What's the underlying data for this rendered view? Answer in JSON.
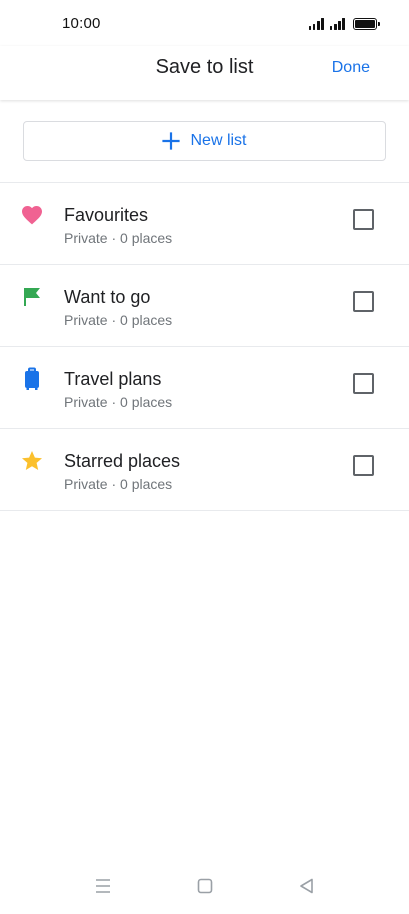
{
  "status_bar": {
    "time": "10:00"
  },
  "header": {
    "title": "Save to list",
    "done_label": "Done"
  },
  "new_list": {
    "label": "New list"
  },
  "lists": [
    {
      "title": "Favourites",
      "subtitle": "Private · 0 places",
      "icon": "heart-icon",
      "icon_color": "#f06292",
      "checked": false
    },
    {
      "title": "Want to go",
      "subtitle": "Private · 0 places",
      "icon": "flag-icon",
      "icon_color": "#34a853",
      "checked": false
    },
    {
      "title": "Travel plans",
      "subtitle": "Private · 0 places",
      "icon": "suitcase-icon",
      "icon_color": "#1a73e8",
      "checked": false
    },
    {
      "title": "Starred places",
      "subtitle": "Private · 0 places",
      "icon": "star-icon",
      "icon_color": "#fbc02d",
      "checked": false
    }
  ],
  "nav_bar": {
    "buttons": [
      "menu-icon",
      "home-square-icon",
      "back-triangle-icon"
    ]
  },
  "colors": {
    "accent": "#1a73e8",
    "text_primary": "#202124",
    "text_secondary": "#70757a",
    "divider": "#e8eaed"
  }
}
